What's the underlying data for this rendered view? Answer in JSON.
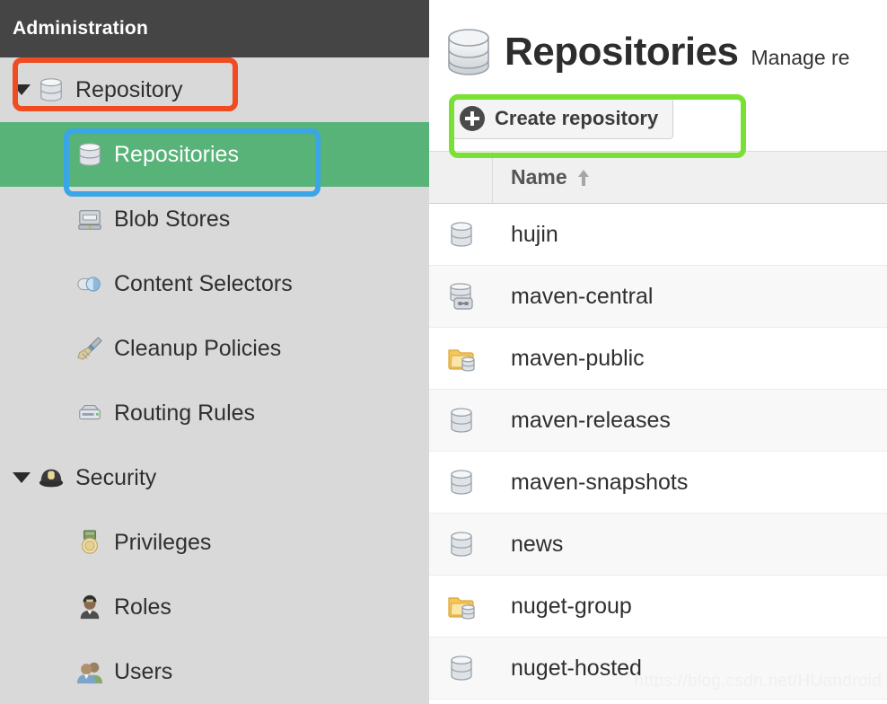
{
  "sidebar": {
    "header_title": "Administration",
    "items": [
      {
        "label": "Repository",
        "icon": "database-icon",
        "level": "group",
        "caret": true,
        "selected": false
      },
      {
        "label": "Repositories",
        "icon": "database-icon",
        "level": "child",
        "caret": false,
        "selected": true
      },
      {
        "label": "Blob Stores",
        "icon": "blob-store-icon",
        "level": "child",
        "caret": false,
        "selected": false
      },
      {
        "label": "Content Selectors",
        "icon": "content-selector-icon",
        "level": "child",
        "caret": false,
        "selected": false
      },
      {
        "label": "Cleanup Policies",
        "icon": "broom-icon",
        "level": "child",
        "caret": false,
        "selected": false
      },
      {
        "label": "Routing Rules",
        "icon": "router-icon",
        "level": "child",
        "caret": false,
        "selected": false
      },
      {
        "label": "Security",
        "icon": "police-hat-icon",
        "level": "group",
        "caret": true,
        "selected": false
      },
      {
        "label": "Privileges",
        "icon": "medal-icon",
        "level": "child",
        "caret": false,
        "selected": false
      },
      {
        "label": "Roles",
        "icon": "officer-icon",
        "level": "child",
        "caret": false,
        "selected": false
      },
      {
        "label": "Users",
        "icon": "users-icon",
        "level": "child",
        "caret": false,
        "selected": false
      }
    ]
  },
  "main": {
    "page_icon": "database-icon",
    "title": "Repositories",
    "subtitle": "Manage re",
    "toolbar": {
      "create_label": "Create repository",
      "create_icon": "plus-circle-icon"
    },
    "table": {
      "columns": [
        {
          "key": "icon",
          "label": ""
        },
        {
          "key": "name",
          "label": "Name",
          "sort": "asc",
          "sort_icon": "sort-asc-arrow-icon"
        }
      ],
      "rows": [
        {
          "name": "hujin",
          "icon": "repo-hosted-icon"
        },
        {
          "name": "maven-central",
          "icon": "repo-proxy-icon"
        },
        {
          "name": "maven-public",
          "icon": "repo-group-icon"
        },
        {
          "name": "maven-releases",
          "icon": "repo-hosted-icon"
        },
        {
          "name": "maven-snapshots",
          "icon": "repo-hosted-icon"
        },
        {
          "name": "news",
          "icon": "repo-hosted-icon"
        },
        {
          "name": "nuget-group",
          "icon": "repo-group-icon"
        },
        {
          "name": "nuget-hosted",
          "icon": "repo-hosted-icon"
        }
      ]
    }
  },
  "annotations": [
    {
      "name": "repository-menu-highlight",
      "color": "#ef4c22"
    },
    {
      "name": "repositories-menu-highlight",
      "color": "#3aa6e8"
    },
    {
      "name": "create-repository-highlight",
      "color": "#79e034"
    }
  ],
  "watermark": {
    "text": "https://blog.csdn.net/HUandroid"
  },
  "colors": {
    "sidebar_header_bg": "#454545",
    "sidebar_bg": "#d9d9d9",
    "selected_bg": "#57b377",
    "annotation_orange": "#ef4c22",
    "annotation_blue": "#3aa6e8",
    "annotation_green": "#79e034"
  }
}
